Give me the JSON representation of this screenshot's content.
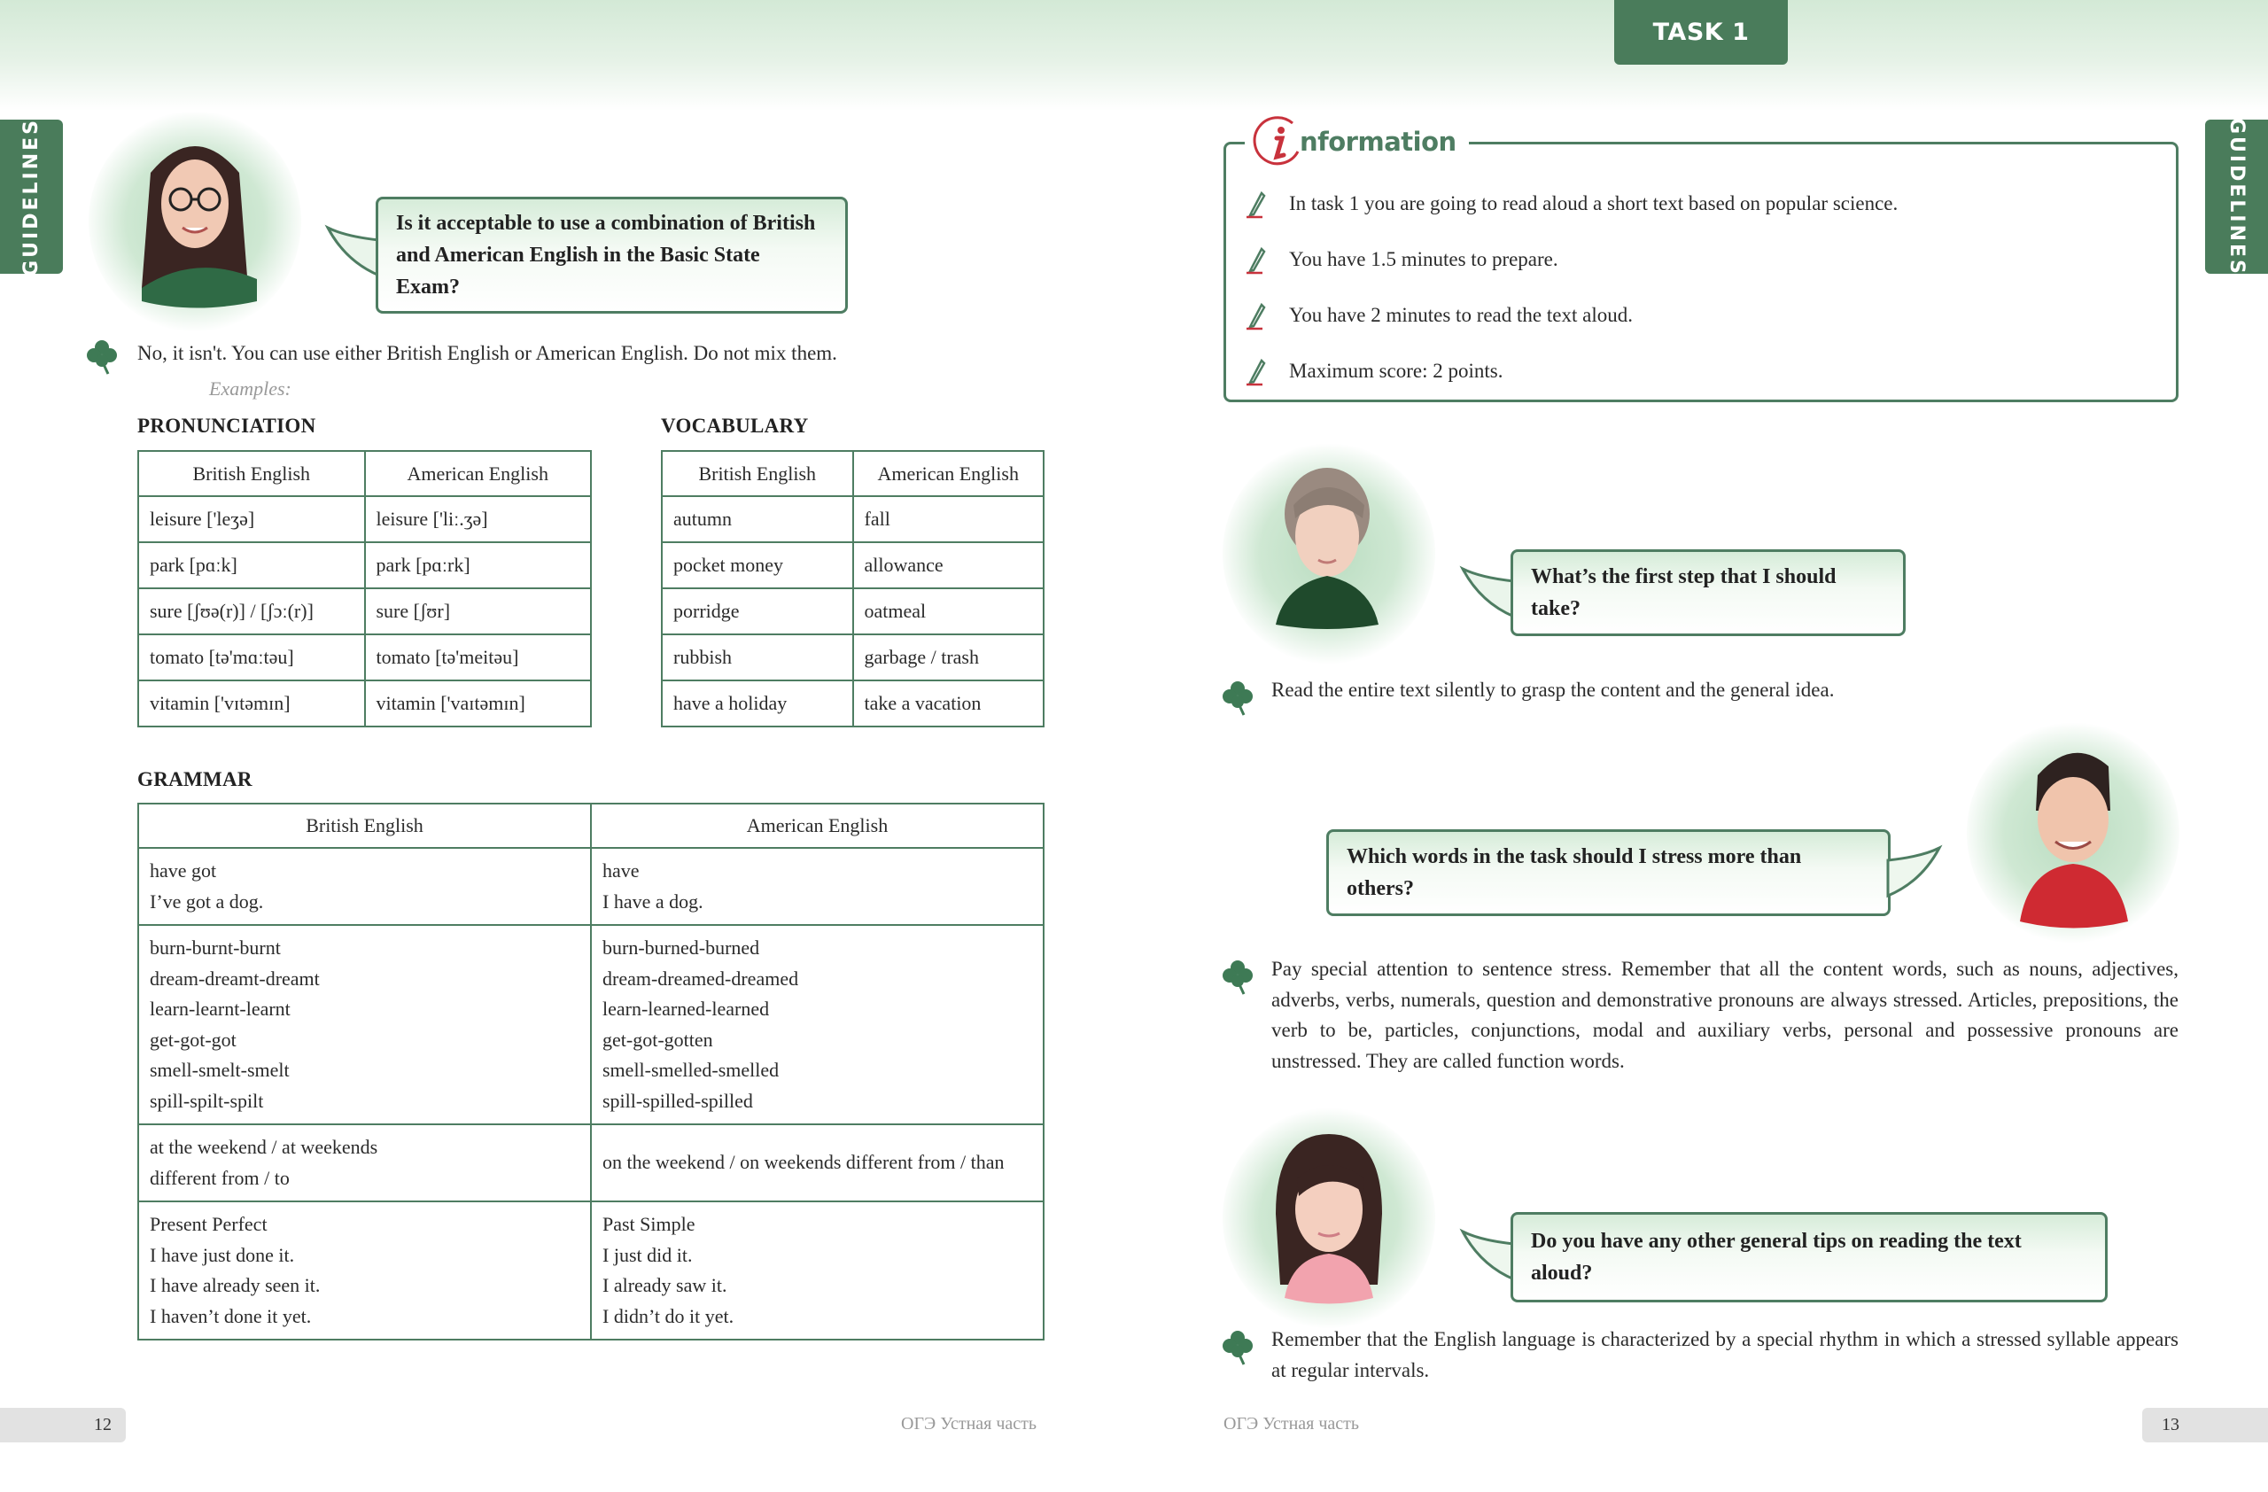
{
  "header": {
    "task_badge": "TASK 1",
    "side_tab_left": "GUIDELINES",
    "side_tab_right": "GUIDELINES"
  },
  "left_page": {
    "question": "Is it acceptable to use a combination of British and American English in the Basic State Exam?",
    "answer": "No, it isn't. You can use either British English or American English. Do not mix them.",
    "examples_label": "Examples:",
    "pronunciation": {
      "label": "PRONUNCIATION",
      "headers": [
        "British English",
        "American English"
      ],
      "rows": [
        [
          "leisure ['leʒə]",
          "leisure ['liː.ʒə]"
        ],
        [
          "park [pɑːk]",
          "park [pɑːrk]"
        ],
        [
          "sure [ʃʊə(r)] / [ʃɔː(r)]",
          "sure [ʃʊr]"
        ],
        [
          "tomato [tə'mɑːtəu]",
          "tomato [tə'meitəu]"
        ],
        [
          "vitamin ['vɪtəmɪn]",
          "vitamin ['vaɪtəmɪn]"
        ]
      ]
    },
    "vocabulary": {
      "label": "VOCABULARY",
      "headers": [
        "British English",
        "American English"
      ],
      "rows": [
        [
          "autumn",
          "fall"
        ],
        [
          "pocket money",
          "allowance"
        ],
        [
          "porridge",
          "oatmeal"
        ],
        [
          "rubbish",
          "garbage / trash"
        ],
        [
          "have a holiday",
          "take a vacation"
        ]
      ]
    },
    "grammar": {
      "label": "GRAMMAR",
      "headers": [
        "British English",
        "American English"
      ],
      "rows": [
        {
          "british": [
            "have got",
            "I’ve got a dog."
          ],
          "american": [
            "have",
            "I have a dog."
          ]
        },
        {
          "british": [
            "burn-burnt-burnt",
            "dream-dreamt-dreamt",
            "learn-learnt-learnt",
            "get-got-got",
            "smell-smelt-smelt",
            "spill-spilt-spilt"
          ],
          "american": [
            "burn-burned-burned",
            "dream-dreamed-dreamed",
            "learn-learned-learned",
            "get-got-gotten",
            "smell-smelled-smelled",
            "spill-spilled-spilled"
          ]
        },
        {
          "british": [
            "at the weekend / at weekends",
            "different from / to"
          ],
          "american": [
            "on the weekend / on weekends different from / than"
          ]
        },
        {
          "british": [
            "Present Perfect",
            "I have just done it.",
            "I have already seen it.",
            "I haven’t done it yet."
          ],
          "american": [
            "Past Simple",
            "I just did it.",
            "I already saw it.",
            "I didn’t do it yet."
          ]
        }
      ]
    },
    "footer": {
      "page_number": "12",
      "book_title": "ОГЭ Устная часть"
    }
  },
  "right_page": {
    "information": {
      "title_letter": "i",
      "title_rest": "nformation",
      "items": [
        "In task 1 you are going to read aloud a short text based on popular science.",
        "You have 1.5 minutes to prepare.",
        "You have 2 minutes to read the text aloud.",
        "Maximum score: 2 points."
      ]
    },
    "qa": [
      {
        "question": "What’s the first step that I should take?",
        "answer": "Read the entire text silently to grasp the content and the general idea."
      },
      {
        "question": "Which words in the task should I stress more than others?",
        "answer": "Pay special attention to sentence stress. Remember that all the content words, such as nouns, adjectives, adverbs, verbs, numerals, question and demonstrative pronouns are always stressed. Articles, prepositions, the verb to be, particles, conjunctions, modal and auxiliary verbs, personal and possessive pronouns are unstressed. They are called function words."
      },
      {
        "question": "Do you have any other general tips on reading the text aloud?",
        "answer": "Remember that the English language is characterized by a special rhythm in which a stressed syllable appears at regular intervals."
      }
    ],
    "footer": {
      "page_number": "13",
      "book_title": "ОГЭ Устная часть"
    }
  },
  "colors": {
    "brand_green": "#4a7c5b",
    "border_green": "#4e7d62",
    "info_red": "#c8323c",
    "header_tint": "#d3e9d6"
  }
}
